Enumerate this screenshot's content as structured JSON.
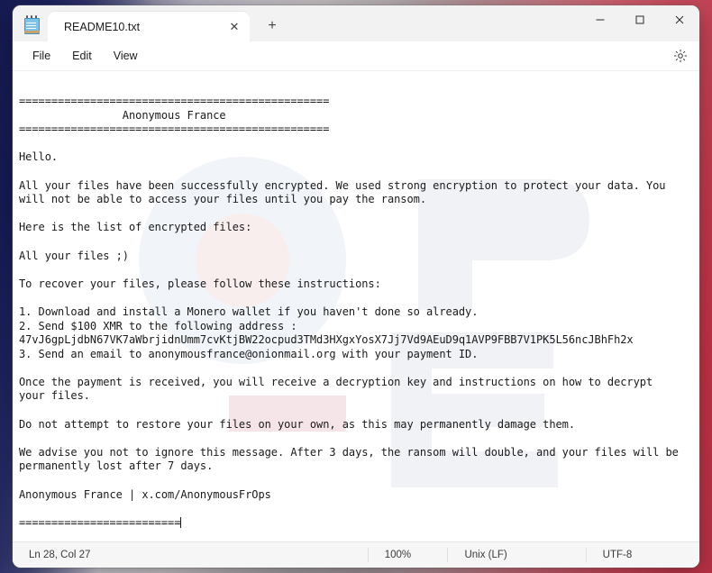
{
  "window": {
    "app_icon": "notepad-icon",
    "tab_title": "README10.txt",
    "close_tab_glyph": "✕",
    "new_tab_glyph": "+",
    "minimize_label": "Minimize",
    "maximize_label": "Maximize",
    "close_label": "Close"
  },
  "menubar": {
    "items": [
      {
        "label": "File"
      },
      {
        "label": "Edit"
      },
      {
        "label": "View"
      }
    ],
    "settings_label": "Settings"
  },
  "editor": {
    "content": "================================================\n                Anonymous France\n================================================\n\nHello.\n\nAll your files have been successfully encrypted. We used strong encryption to protect your data. You\nwill not be able to access your files until you pay the ransom.\n\nHere is the list of encrypted files:\n\nAll your files ;)\n\nTo recover your files, please follow these instructions:\n\n1. Download and install a Monero wallet if you haven't done so already.\n2. Send $100 XMR to the following address :\n47vJ6gpLjdbN67VK7aWbrjidnUmm7cvKtjBW22ocpud3TMd3HXgxYosX7Jj7Vd9AEuD9q1AVP9FBB7V1PK5L56ncJBhFh2x\n3. Send an email to anonymousfrance@onionmail.org with your payment ID.\n\nOnce the payment is received, you will receive a decryption key and instructions on how to decrypt\nyour files.\n\nDo not attempt to restore your files on your own, as this may permanently damage them.\n\nWe advise you not to ignore this message. After 3 days, the ransom will double, and your files will be\npermanently lost after 7 days.\n\nAnonymous France | x.com/AnonymousFrOps\n\n=========================",
    "watermark_text": "PCrisk"
  },
  "statusbar": {
    "ln_col": "Ln 28, Col 27",
    "zoom": "100%",
    "line_ending": "Unix (LF)",
    "encoding": "UTF-8"
  },
  "colors": {
    "window_bg": "#ffffff",
    "titlebar_bg": "#f2f2f2",
    "statusbar_bg": "#f6f6f6",
    "text": "#1a1a1a",
    "wallpaper_blue": "#1b1f4b",
    "wallpaper_red": "#bd4c5c"
  }
}
